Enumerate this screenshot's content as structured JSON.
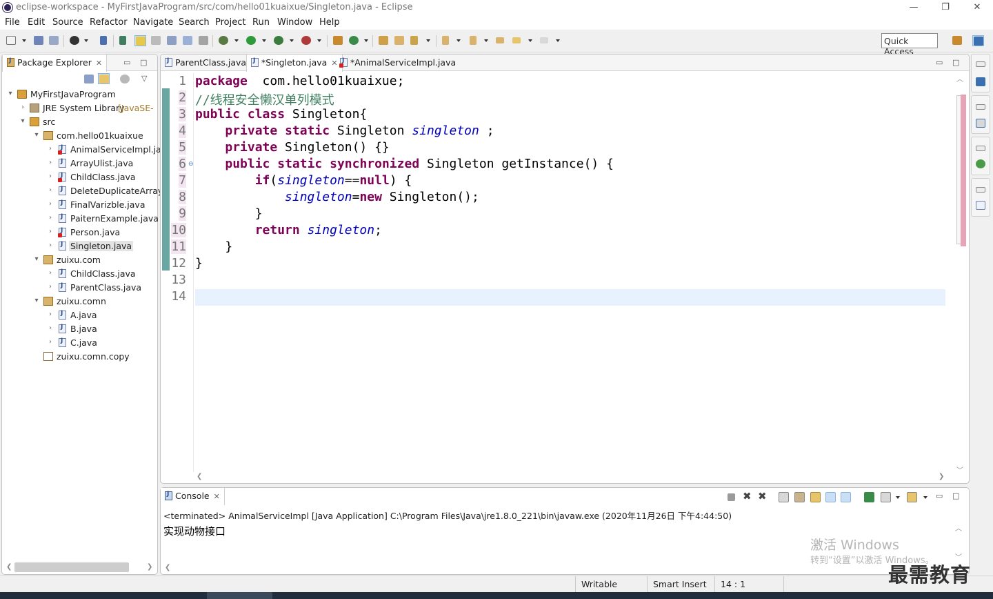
{
  "window": {
    "title": "eclipse-workspace - MyFirstJavaProgram/src/com/hello01kuaixue/Singleton.java - Eclipse",
    "minimize": "—",
    "restore": "❐",
    "close": "✕"
  },
  "menu": [
    "File",
    "Edit",
    "Source",
    "Refactor",
    "Navigate",
    "Search",
    "Project",
    "Run",
    "Window",
    "Help"
  ],
  "toolbar": {
    "quick_access": "Quick Access"
  },
  "package_explorer": {
    "title": "Package Explorer",
    "tree": [
      {
        "label": "MyFirstJavaProgram",
        "level": 0,
        "arrow": "▾",
        "icon": "project-icon"
      },
      {
        "label": "JRE System Library",
        "decor": " [JavaSE-",
        "level": 1,
        "arrow": "›",
        "icon": "library-icon"
      },
      {
        "label": "src",
        "level": 1,
        "arrow": "▾",
        "icon": "source-folder-icon"
      },
      {
        "label": "com.hello01kuaixue",
        "level": 2,
        "arrow": "▾",
        "icon": "package-icon"
      },
      {
        "label": "AnimalServiceImpl.ja",
        "level": 3,
        "arrow": "›",
        "icon": "java-file-error-icon"
      },
      {
        "label": "ArrayUlist.java",
        "level": 3,
        "arrow": "›",
        "icon": "java-file-icon"
      },
      {
        "label": "ChildClass.java",
        "level": 3,
        "arrow": "›",
        "icon": "java-file-error-icon"
      },
      {
        "label": "DeleteDuplicateArray",
        "level": 3,
        "arrow": "›",
        "icon": "java-file-icon"
      },
      {
        "label": "FinalVarizble.java",
        "level": 3,
        "arrow": "›",
        "icon": "java-file-icon"
      },
      {
        "label": "PaiternExample.java",
        "level": 3,
        "arrow": "›",
        "icon": "java-file-icon"
      },
      {
        "label": "Person.java",
        "level": 3,
        "arrow": "›",
        "icon": "java-file-error-icon"
      },
      {
        "label": "Singleton.java",
        "level": 3,
        "arrow": "›",
        "icon": "java-file-icon",
        "selected": true
      },
      {
        "label": "zuixu.com",
        "level": 2,
        "arrow": "▾",
        "icon": "package-icon"
      },
      {
        "label": "ChildClass.java",
        "level": 3,
        "arrow": "›",
        "icon": "java-file-icon"
      },
      {
        "label": "ParentClass.java",
        "level": 3,
        "arrow": "›",
        "icon": "java-file-icon"
      },
      {
        "label": "zuixu.comn",
        "level": 2,
        "arrow": "▾",
        "icon": "package-icon"
      },
      {
        "label": "A.java",
        "level": 3,
        "arrow": "›",
        "icon": "java-file-icon"
      },
      {
        "label": "B.java",
        "level": 3,
        "arrow": "›",
        "icon": "java-file-icon"
      },
      {
        "label": "C.java",
        "level": 3,
        "arrow": "›",
        "icon": "java-file-icon"
      },
      {
        "label": "zuixu.comn.copy",
        "level": 2,
        "arrow": "",
        "icon": "package-empty-icon"
      }
    ]
  },
  "editor": {
    "tabs": [
      {
        "label": "ParentClass.java",
        "error": false,
        "active": false
      },
      {
        "label": "*Singleton.java",
        "error": false,
        "active": true
      },
      {
        "label": "*AnimalServiceImpl.java",
        "error": true,
        "active": false
      }
    ],
    "line_numbers": [
      "1",
      "2",
      "3",
      "4",
      "5",
      "6",
      "7",
      "8",
      "9",
      "10",
      "11",
      "12",
      "13",
      "14"
    ],
    "code": [
      [
        [
          "kw",
          "package"
        ],
        [
          "",
          "  com.hello01kuaixue;"
        ]
      ],
      [
        [
          "cm",
          "//线程安全懒汉单列模式"
        ]
      ],
      [
        [
          "kw",
          "public"
        ],
        [
          "",
          " "
        ],
        [
          "kw",
          "class"
        ],
        [
          "",
          " Singleton{"
        ]
      ],
      [
        [
          "",
          "    "
        ],
        [
          "kw",
          "private"
        ],
        [
          "",
          " "
        ],
        [
          "kw",
          "static"
        ],
        [
          "",
          " Singleton "
        ],
        [
          "fld",
          "singleton"
        ],
        [
          "",
          " ;"
        ]
      ],
      [
        [
          "",
          "    "
        ],
        [
          "kw",
          "private"
        ],
        [
          "",
          " Singleton() {}"
        ]
      ],
      [
        [
          "",
          "    "
        ],
        [
          "kw",
          "public"
        ],
        [
          "",
          " "
        ],
        [
          "kw",
          "static"
        ],
        [
          "",
          " "
        ],
        [
          "kw",
          "synchronized"
        ],
        [
          "",
          " Singleton getInstance() {"
        ]
      ],
      [
        [
          "",
          "        "
        ],
        [
          "kw",
          "if"
        ],
        [
          "",
          "("
        ],
        [
          "fld",
          "singleton"
        ],
        [
          "",
          "=="
        ],
        [
          "kw",
          "null"
        ],
        [
          "",
          ") {"
        ]
      ],
      [
        [
          "",
          "            "
        ],
        [
          "fld",
          "singleton"
        ],
        [
          "",
          "="
        ],
        [
          "kw",
          "new"
        ],
        [
          "",
          " Singleton();"
        ]
      ],
      [
        [
          "",
          "        }"
        ]
      ],
      [
        [
          "",
          "        "
        ],
        [
          "kw",
          "return"
        ],
        [
          "",
          " "
        ],
        [
          "fld",
          "singleton"
        ],
        [
          "",
          ";"
        ]
      ],
      [
        [
          "",
          "    }"
        ]
      ],
      [
        [
          "",
          "}"
        ]
      ],
      [
        [
          "",
          ""
        ]
      ],
      [
        [
          "",
          ""
        ]
      ]
    ]
  },
  "console": {
    "title": "Console",
    "terminated": "<terminated> AnimalServiceImpl [Java Application] C:\\Program Files\\Java\\jre1.8.0_221\\bin\\javaw.exe (2020年11月26日 下午4:44:50)",
    "output": "实现动物接口"
  },
  "status": {
    "writable": "Writable",
    "insert_mode": "Smart Insert",
    "position": "14 : 1"
  },
  "watermark": {
    "line1": "激活 Windows",
    "line2": "转到“设置”以激活 Windows。",
    "logo": "最需教育"
  }
}
